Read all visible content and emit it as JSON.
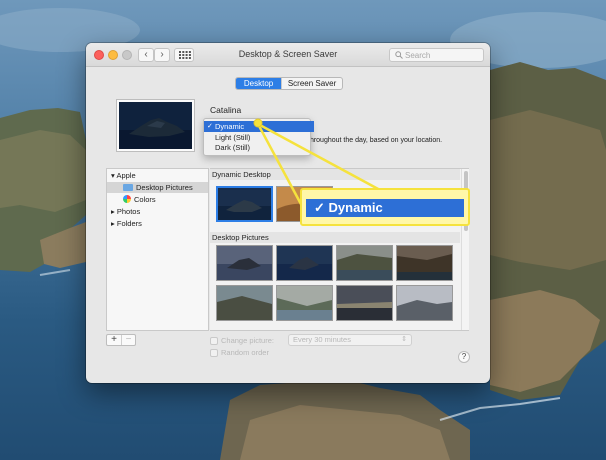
{
  "window": {
    "title": "Desktop & Screen Saver",
    "search_placeholder": "Search",
    "nav_back": "‹",
    "nav_forward": "›"
  },
  "tabs": [
    {
      "label": "Desktop",
      "selected": true
    },
    {
      "label": "Screen Saver",
      "selected": false
    }
  ],
  "theme": {
    "name": "Catalina",
    "description_fragment": "throughout the day, based on your location."
  },
  "dropdown": {
    "options": [
      {
        "label": "Dynamic",
        "selected": true,
        "check": "✓"
      },
      {
        "label": "Light (Still)",
        "selected": false
      },
      {
        "label": "Dark (Still)",
        "selected": false
      }
    ]
  },
  "sidebar": {
    "groups": [
      {
        "label": "Apple",
        "expanded": true,
        "items": [
          {
            "label": "Desktop Pictures",
            "selected": true,
            "icon": "folder-icon"
          },
          {
            "label": "Colors",
            "selected": false,
            "icon": "colors-icon"
          }
        ]
      },
      {
        "label": "Photos",
        "expanded": false
      },
      {
        "label": "Folders",
        "expanded": false
      }
    ]
  },
  "sections": {
    "dynamic_desktop": "Dynamic Desktop",
    "desktop_pictures": "Desktop Pictures"
  },
  "footer": {
    "add": "+",
    "remove": "−",
    "change_picture_label": "Change picture:",
    "change_picture_interval": "Every 30 minutes",
    "random_order_label": "Random order",
    "help": "?"
  },
  "callout": {
    "check": "✓",
    "label": "Dynamic"
  },
  "colors": {
    "accent": "#2d7ee6",
    "callout_highlight": "#f5e23d"
  }
}
